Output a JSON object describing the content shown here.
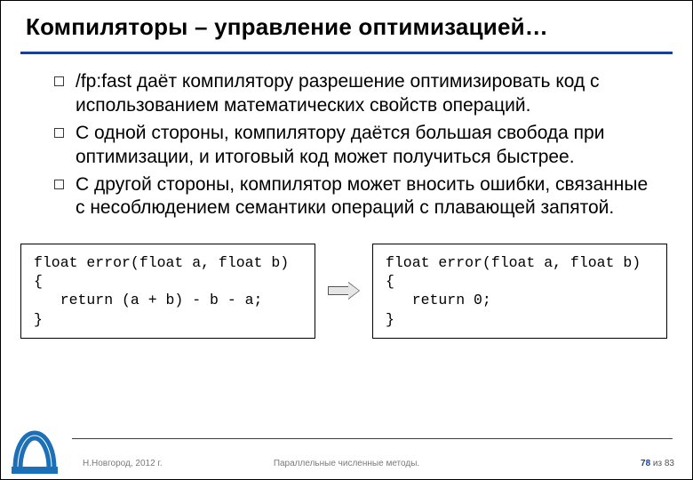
{
  "title": "Компиляторы – управление оптимизацией…",
  "bullets": [
    "/fp:fast даёт компилятору разрешение оптимизировать код с использованием математических свойств операций.",
    "С одной стороны, компилятору даётся большая свобода при оптимизации, и итоговый код может получиться быстрее.",
    "С другой стороны, компилятор может вносить ошибки, связанные с несоблюдением семантики операций с плавающей запятой."
  ],
  "code": {
    "left": "float error(float a, float b)\n{\n   return (a + b) - b - a;\n}",
    "right": "float error(float a, float b)\n{\n   return 0;\n}"
  },
  "footer": {
    "left": "Н.Новгород, 2012 г.",
    "center": "Параллельные численные методы.",
    "page_current": "78",
    "page_sep": " из ",
    "page_total": "83"
  },
  "colors": {
    "accent": "#1c3f94"
  }
}
